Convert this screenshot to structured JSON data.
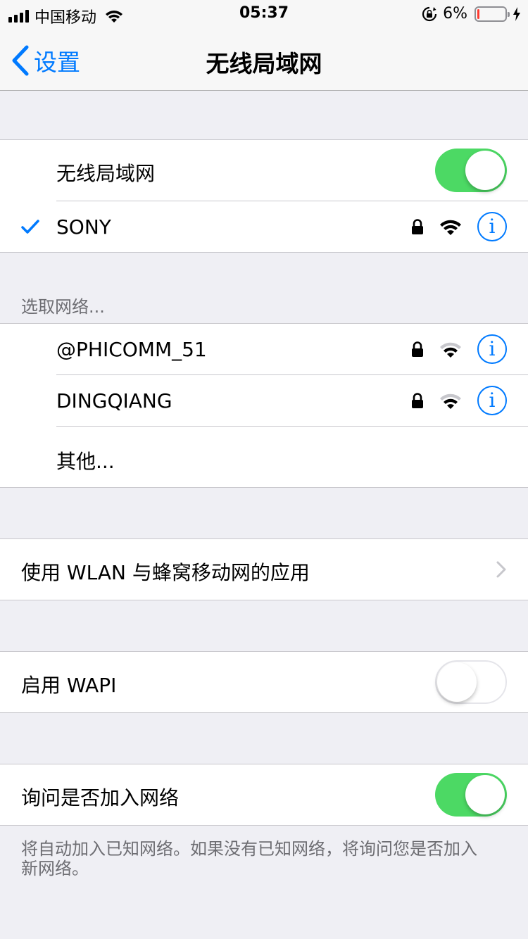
{
  "status_bar": {
    "carrier": "中国移动",
    "time": "05:37",
    "battery_percent": "6%",
    "battery_level": 0.06,
    "icons": [
      "signal-icon",
      "wifi-icon",
      "rotation-lock-icon",
      "battery-icon",
      "charging-bolt-icon"
    ]
  },
  "nav": {
    "back_label": "设置",
    "title": "无线局域网"
  },
  "wifi_section": {
    "toggle_label": "无线局域网",
    "toggle_on": true,
    "connected_network": {
      "name": "SONY",
      "secured": true,
      "signal": "full"
    }
  },
  "networks_section": {
    "header": "选取网络...",
    "networks": [
      {
        "name": "@PHICOMM_51",
        "secured": true,
        "signal": "medium"
      },
      {
        "name": "DINGQIANG",
        "secured": true,
        "signal": "medium"
      }
    ],
    "other_label": "其他..."
  },
  "apps_row": {
    "label": "使用 WLAN 与蜂窝移动网的应用"
  },
  "wapi_row": {
    "label": "启用 WAPI",
    "toggle_on": false
  },
  "ask_join_row": {
    "label": "询问是否加入网络",
    "toggle_on": true,
    "footer_line1": "将自动加入已知网络。如果没有已知网络，将询问您是否加入",
    "footer_line2": "新网络。"
  },
  "colors": {
    "accent": "#007aff",
    "toggle_on": "#4cd964",
    "background": "#efeff4",
    "battery_low": "#ff3b30"
  }
}
